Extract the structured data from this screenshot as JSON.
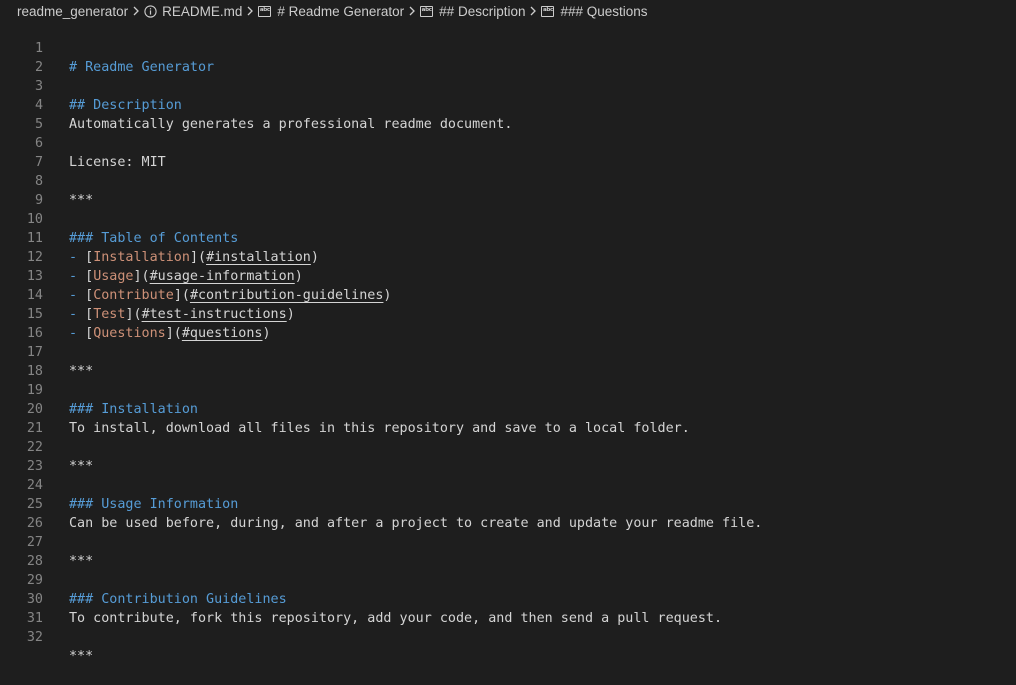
{
  "breadcrumb": {
    "folder": "readme_generator",
    "file": "README.md",
    "h1": "# Readme Generator",
    "h2": "## Description",
    "h3": "### Questions"
  },
  "editor": {
    "line_numbers": [
      "1",
      "2",
      "3",
      "4",
      "5",
      "6",
      "7",
      "8",
      "9",
      "10",
      "11",
      "12",
      "13",
      "14",
      "15",
      "16",
      "17",
      "18",
      "19",
      "20",
      "21",
      "22",
      "23",
      "24",
      "25",
      "26",
      "27",
      "28",
      "29",
      "30",
      "31",
      "32"
    ],
    "h1_title": "# Readme Generator",
    "desc_heading": "## Description",
    "desc_text": "Automatically generates a professional readme document.",
    "license": "License: MIT",
    "hr": "***",
    "toc_heading": "### Table of Contents",
    "toc": [
      {
        "bullet": "- ",
        "open": "[",
        "text": "Installation",
        "mid": "](",
        "href": "#installation",
        "close": ")"
      },
      {
        "bullet": "- ",
        "open": "[",
        "text": "Usage",
        "mid": "](",
        "href": "#usage-information",
        "close": ")"
      },
      {
        "bullet": "- ",
        "open": "[",
        "text": "Contribute",
        "mid": "](",
        "href": "#contribution-guidelines",
        "close": ")"
      },
      {
        "bullet": "- ",
        "open": "[",
        "text": "Test",
        "mid": "](",
        "href": "#test-instructions",
        "close": ")"
      },
      {
        "bullet": "- ",
        "open": "[",
        "text": "Questions",
        "mid": "](",
        "href": "#questions",
        "close": ")"
      }
    ],
    "install_heading": "### Installation",
    "install_text": "To install, download all files in this repository and save to a local folder.",
    "usage_heading": "### Usage Information",
    "usage_text": "Can be used before, during, and after a project to create and update your readme file.",
    "contrib_heading": "### Contribution Guidelines",
    "contrib_text": "To contribute, fork this repository, add your code, and then send a pull request."
  },
  "colors": {
    "background": "#1e1e1e",
    "line_number": "#858585",
    "heading": "#569cd6",
    "link_text": "#ce9178",
    "plain_text": "#d4d4d4"
  }
}
